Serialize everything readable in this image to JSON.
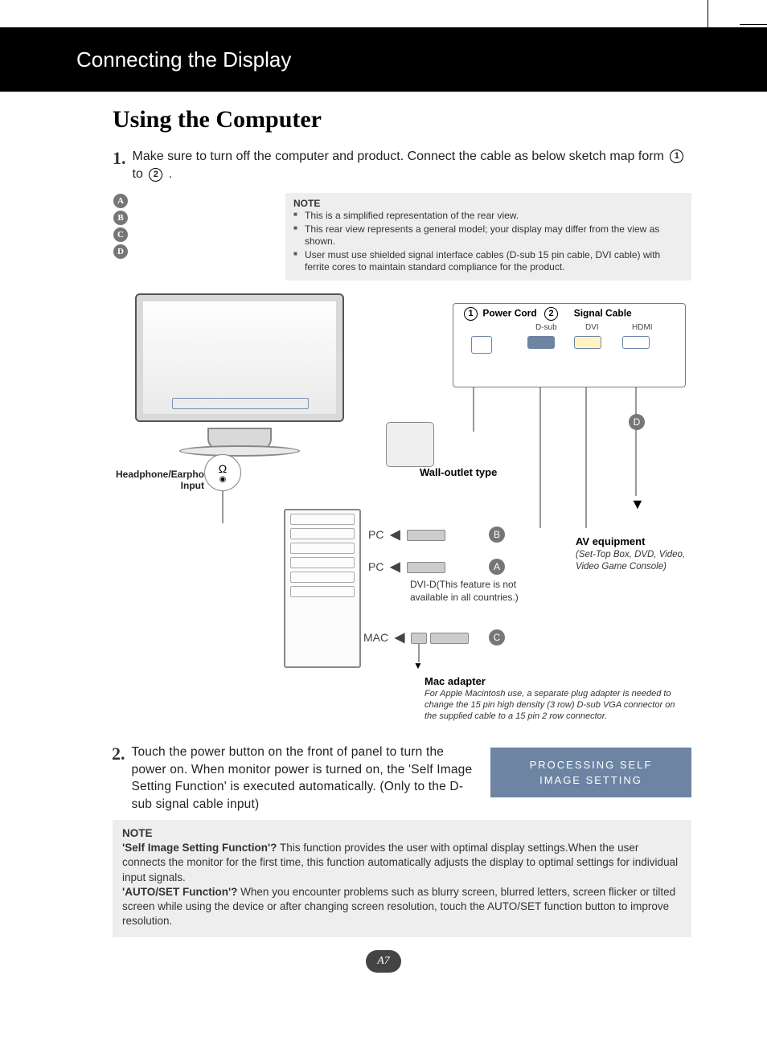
{
  "header": {
    "title": "Connecting the Display"
  },
  "section_title": "Using the Computer",
  "step1": {
    "num": "1.",
    "text_a": "Make sure to turn off the computer and  product. Connect the cable as below sketch map form ",
    "text_b": " to ",
    "text_c": " .",
    "circ1": "1",
    "circ2": "2"
  },
  "badges": [
    "A",
    "B",
    "C",
    "D"
  ],
  "note1": {
    "label": "NOTE",
    "items": [
      "This is a simplified representation of the rear view.",
      "This rear view represents a general model; your display may differ from the view as shown.",
      "User must use shielded signal interface cables (D-sub 15 pin cable, DVI cable) with ferrite cores to maintain standard compliance for the product."
    ]
  },
  "diagram": {
    "power_cord_num": "1",
    "power_cord": "Power Cord",
    "signal_num": "2",
    "signal_cable": "Signal Cable",
    "dsub": "D-sub",
    "dvi": "DVI",
    "hdmi": "HDMI",
    "hp_label": "Headphone/Earphone Input",
    "wall_label": "Wall-outlet type",
    "pc": "PC",
    "mac": "MAC",
    "dvid_note": "DVI-D(This feature is not available in all countries.)",
    "av_title": "AV equipment",
    "av_sub": "(Set-Top Box, DVD, Video, Video Game Console)",
    "mac_title": "Mac adapter",
    "mac_sub": "For Apple Macintosh use, a  separate plug adapter is needed to change the 15 pin high density (3 row) D-sub VGA connector on the supplied cable to a 15 pin  2 row connector.",
    "routeA": "A",
    "routeB": "B",
    "routeC": "C",
    "routeD": "D"
  },
  "step2": {
    "num": "2.",
    "text": "Touch the power button on the front of panel to turn the power on. When monitor power is turned on, the 'Self Image Setting Function' is executed automatically. (Only to the D-sub signal cable input)"
  },
  "processing": {
    "line1": "PROCESSING SELF",
    "line2": "IMAGE SETTING"
  },
  "note2": {
    "label": "NOTE",
    "q1": "'Self Image Setting Function'?",
    "a1": " This function provides the user with optimal display settings.When the user connects the monitor for the first time, this function automatically adjusts the display to optimal settings for individual input signals.",
    "q2": "'AUTO/SET Function'?",
    "a2": " When you encounter problems such as blurry screen, blurred letters, screen flicker or tilted screen while using the device or after changing screen resolution, touch the AUTO/SET function button to improve resolution."
  },
  "page_num": "A7"
}
